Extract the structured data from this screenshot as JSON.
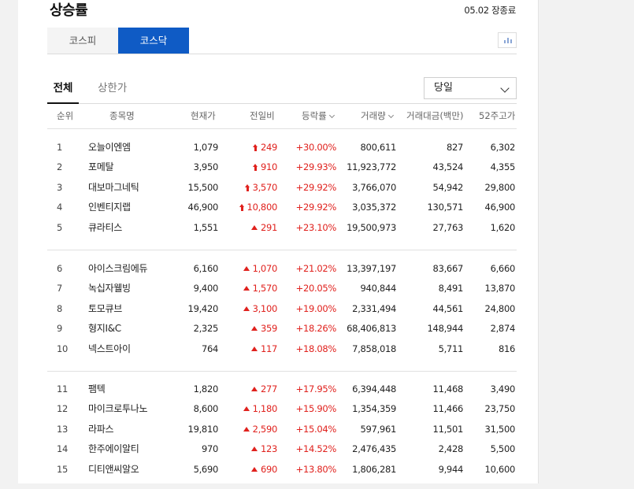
{
  "page": {
    "title": "상승률",
    "date": "05.02 장종료"
  },
  "market_tabs": [
    "코스피",
    "코스닥"
  ],
  "active_market": "코스닥",
  "sub_tabs": [
    "전체",
    "상한가"
  ],
  "period_select": {
    "value": "당일"
  },
  "icons": {
    "chart_toggle": "bar-chart-icon",
    "dropdown": "chevron-down-icon",
    "upper_limit": "upper-limit-arrow-icon",
    "rise": "rise-triangle-icon",
    "sort": "sort-down-icon"
  },
  "colors": {
    "active_tab": "#0f5bc5",
    "up": "#e0211d"
  },
  "columns": {
    "rank": "순위",
    "name": "종목명",
    "price": "현재가",
    "change": "전일비",
    "rate": "등락률",
    "volume": "거래량",
    "amount": "거래대금(백만)",
    "high52": "52주고가"
  },
  "groups": [
    [
      {
        "rank": "1",
        "name": "오늘이엔엠",
        "price": "1,079",
        "indicator": "limit",
        "change": "249",
        "rate": "+30.00%",
        "volume": "800,611",
        "amount": "827",
        "high52": "6,302"
      },
      {
        "rank": "2",
        "name": "포메탈",
        "price": "3,950",
        "indicator": "limit",
        "change": "910",
        "rate": "+29.93%",
        "volume": "11,923,772",
        "amount": "43,524",
        "high52": "4,355"
      },
      {
        "rank": "3",
        "name": "대보마그네틱",
        "price": "15,500",
        "indicator": "limit",
        "change": "3,570",
        "rate": "+29.92%",
        "volume": "3,766,070",
        "amount": "54,942",
        "high52": "29,800"
      },
      {
        "rank": "4",
        "name": "인벤티지랩",
        "price": "46,900",
        "indicator": "limit",
        "change": "10,800",
        "rate": "+29.92%",
        "volume": "3,035,372",
        "amount": "130,571",
        "high52": "46,900"
      },
      {
        "rank": "5",
        "name": "큐라티스",
        "price": "1,551",
        "indicator": "up",
        "change": "291",
        "rate": "+23.10%",
        "volume": "19,500,973",
        "amount": "27,763",
        "high52": "1,620"
      }
    ],
    [
      {
        "rank": "6",
        "name": "아이스크림에듀",
        "price": "6,160",
        "indicator": "up",
        "change": "1,070",
        "rate": "+21.02%",
        "volume": "13,397,197",
        "amount": "83,667",
        "high52": "6,660"
      },
      {
        "rank": "7",
        "name": "녹십자웰빙",
        "price": "9,400",
        "indicator": "up",
        "change": "1,570",
        "rate": "+20.05%",
        "volume": "940,844",
        "amount": "8,491",
        "high52": "13,870"
      },
      {
        "rank": "8",
        "name": "토모큐브",
        "price": "19,420",
        "indicator": "up",
        "change": "3,100",
        "rate": "+19.00%",
        "volume": "2,331,494",
        "amount": "44,561",
        "high52": "24,800"
      },
      {
        "rank": "9",
        "name": "형지I&C",
        "price": "2,325",
        "indicator": "up",
        "change": "359",
        "rate": "+18.26%",
        "volume": "68,406,813",
        "amount": "148,944",
        "high52": "2,874"
      },
      {
        "rank": "10",
        "name": "넥스트아이",
        "price": "764",
        "indicator": "up",
        "change": "117",
        "rate": "+18.08%",
        "volume": "7,858,018",
        "amount": "5,711",
        "high52": "816"
      }
    ],
    [
      {
        "rank": "11",
        "name": "팸텍",
        "price": "1,820",
        "indicator": "up",
        "change": "277",
        "rate": "+17.95%",
        "volume": "6,394,448",
        "amount": "11,468",
        "high52": "3,490"
      },
      {
        "rank": "12",
        "name": "마이크로투나노",
        "price": "8,600",
        "indicator": "up",
        "change": "1,180",
        "rate": "+15.90%",
        "volume": "1,354,359",
        "amount": "11,466",
        "high52": "23,750"
      },
      {
        "rank": "13",
        "name": "라파스",
        "price": "19,810",
        "indicator": "up",
        "change": "2,590",
        "rate": "+15.04%",
        "volume": "597,961",
        "amount": "11,501",
        "high52": "31,500"
      },
      {
        "rank": "14",
        "name": "한주에이알티",
        "price": "970",
        "indicator": "up",
        "change": "123",
        "rate": "+14.52%",
        "volume": "2,476,435",
        "amount": "2,428",
        "high52": "5,500"
      },
      {
        "rank": "15",
        "name": "디티앤씨알오",
        "price": "5,690",
        "indicator": "up",
        "change": "690",
        "rate": "+13.80%",
        "volume": "1,806,281",
        "amount": "9,944",
        "high52": "10,600"
      }
    ]
  ]
}
